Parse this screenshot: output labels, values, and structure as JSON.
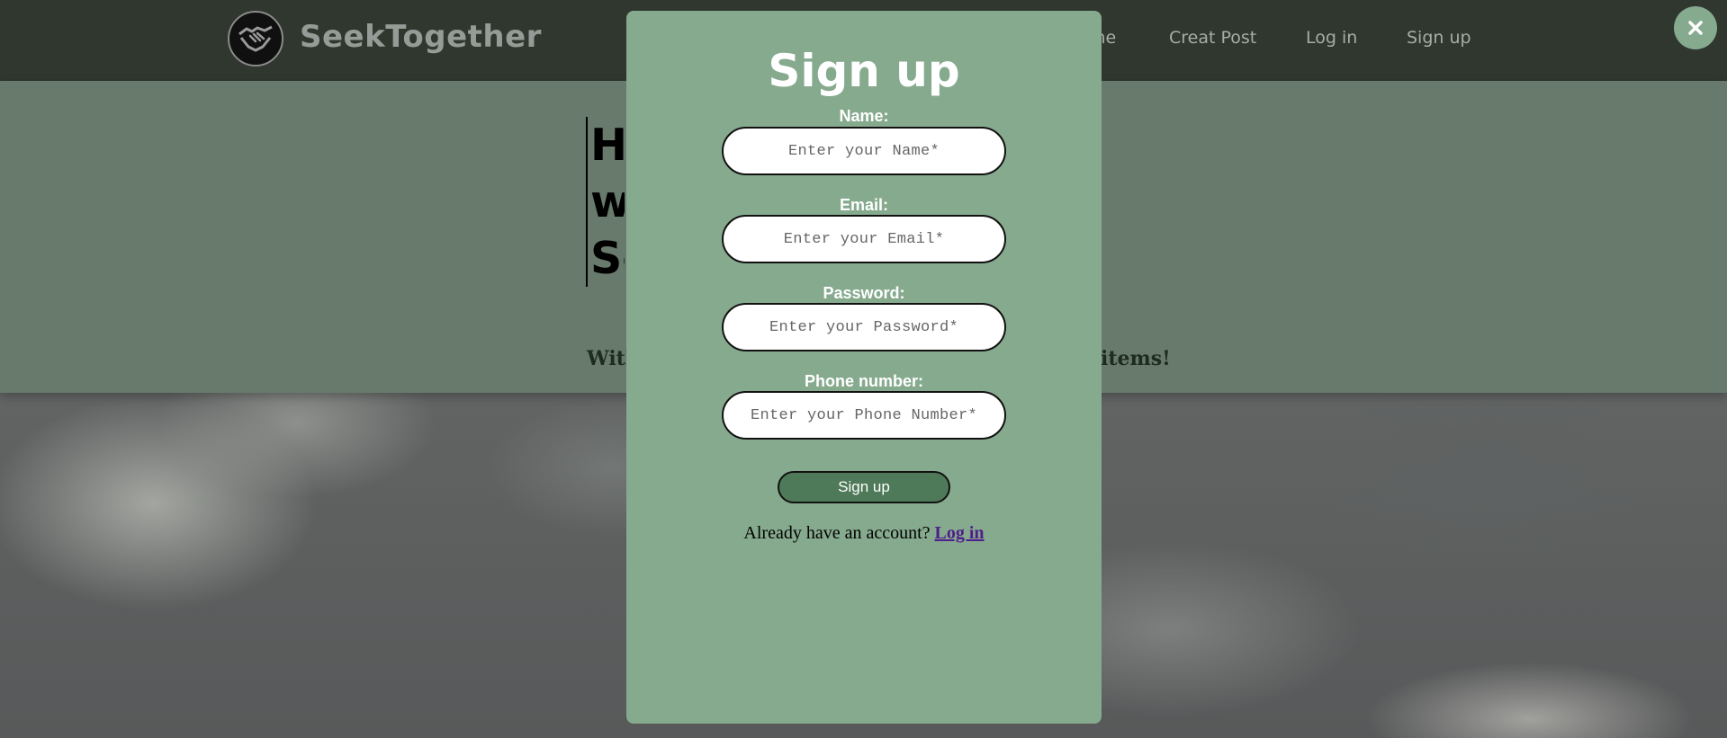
{
  "navbar": {
    "brand": "SeekTogether",
    "links": {
      "home_partial": "me",
      "creat_post": "Creat Post",
      "log_in": "Log in",
      "sign_up": "Sign up"
    },
    "logo_icon": "handshake-icon"
  },
  "hero": {
    "title_lines": [
      "He",
      "wi",
      "Se"
    ],
    "subtitle_left": "With",
    "subtitle_right": "items!"
  },
  "modal": {
    "title": "Sign up",
    "fields": [
      {
        "label": "Name:",
        "placeholder": "Enter your Name*"
      },
      {
        "label": "Email:",
        "placeholder": "Enter your Email*"
      },
      {
        "label": "Password:",
        "placeholder": "Enter your Password*"
      },
      {
        "label": "Phone number:",
        "placeholder": "Enter your Phone Number*"
      }
    ],
    "submit_label": "Sign up",
    "login_prompt": "Already have an account?",
    "login_link": "Log in"
  },
  "close_icon": "close-icon",
  "colors": {
    "navbar_bg": "#2f372f",
    "modal_bg": "#86aa8e",
    "button_bg": "#4f7a59",
    "hero_overlay": "#687a6c"
  }
}
